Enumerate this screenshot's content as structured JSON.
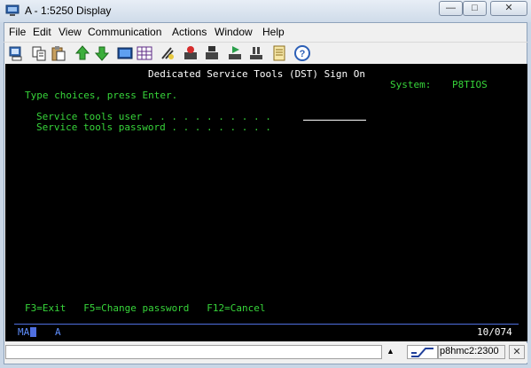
{
  "window": {
    "title": "A - 1:5250 Display",
    "minimize_glyph": "—",
    "maximize_glyph": "□",
    "close_glyph": "✕"
  },
  "menu": [
    "File",
    "Edit",
    "View",
    "Communication",
    "Actions",
    "Window",
    "Help"
  ],
  "toolbar": {
    "icons": [
      "print-screen-icon",
      "copy-icon",
      "paste-icon",
      "send-icon",
      "receive-icon",
      "display-icon",
      "keypad-icon",
      "macro-icon",
      "record-macro-icon",
      "stop-macro-icon",
      "play-macro-icon",
      "pause-icon",
      "notes-icon",
      "help-icon"
    ]
  },
  "terminal": {
    "screen_title": "Dedicated Service Tools (DST) Sign On",
    "system_label": "System:",
    "system_value": "P8TIOS",
    "instruction": "Type choices, press Enter.",
    "field_user_label": "Service tools user . . . . . . . . . . .",
    "field_password_label": "Service tools password . . . . . . . . .",
    "field_user_value": "",
    "fkeys": "F3=Exit   F5=Change password   F12=Cancel",
    "oia_left": "MA",
    "oia_mode": "A",
    "cursor_pos": "10/074"
  },
  "status": {
    "message": "",
    "arrow": "▲",
    "host": "p8hmc2:2300",
    "close_glyph": "✕"
  },
  "colors": {
    "screen_background": "#000000",
    "text_green": "#37d53a",
    "text_white": "#ffffff",
    "oia_blue": "#4f6fe0"
  }
}
